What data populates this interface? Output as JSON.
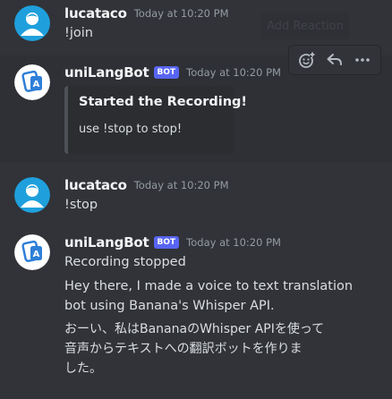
{
  "messages": [
    {
      "username": "lucataco",
      "timestamp": "Today at 10:20 PM",
      "content": "!join"
    },
    {
      "username": "uniLangBot",
      "bot_tag": "BOT",
      "timestamp": "Today at 10:20 PM",
      "embed": {
        "title": "Started the Recording!",
        "description": "use !stop to stop!"
      }
    },
    {
      "username": "lucataco",
      "timestamp": "Today at 10:20 PM",
      "content": "!stop"
    },
    {
      "username": "uniLangBot",
      "bot_tag": "BOT",
      "timestamp": "Today at 10:20 PM",
      "lines": [
        "Recording stopped",
        "Hey there, I made a voice to text translation",
        "bot using Banana's Whisper API.",
        "おーい、私はBananaのWhisper APIを使って",
        "音声からテキストへの翻訳ボットを作りま",
        "した。"
      ]
    }
  ],
  "toolbar": {
    "add_reaction_tooltip": "Add Reaction",
    "icons": [
      "add-reaction-icon",
      "reply-icon",
      "more-icon"
    ]
  },
  "colors": {
    "background": "#313338",
    "bot_tag": "#5865f2",
    "avatar_blue": "#1fa0dc",
    "bot_avatar_blue": "#2f7fd8"
  }
}
